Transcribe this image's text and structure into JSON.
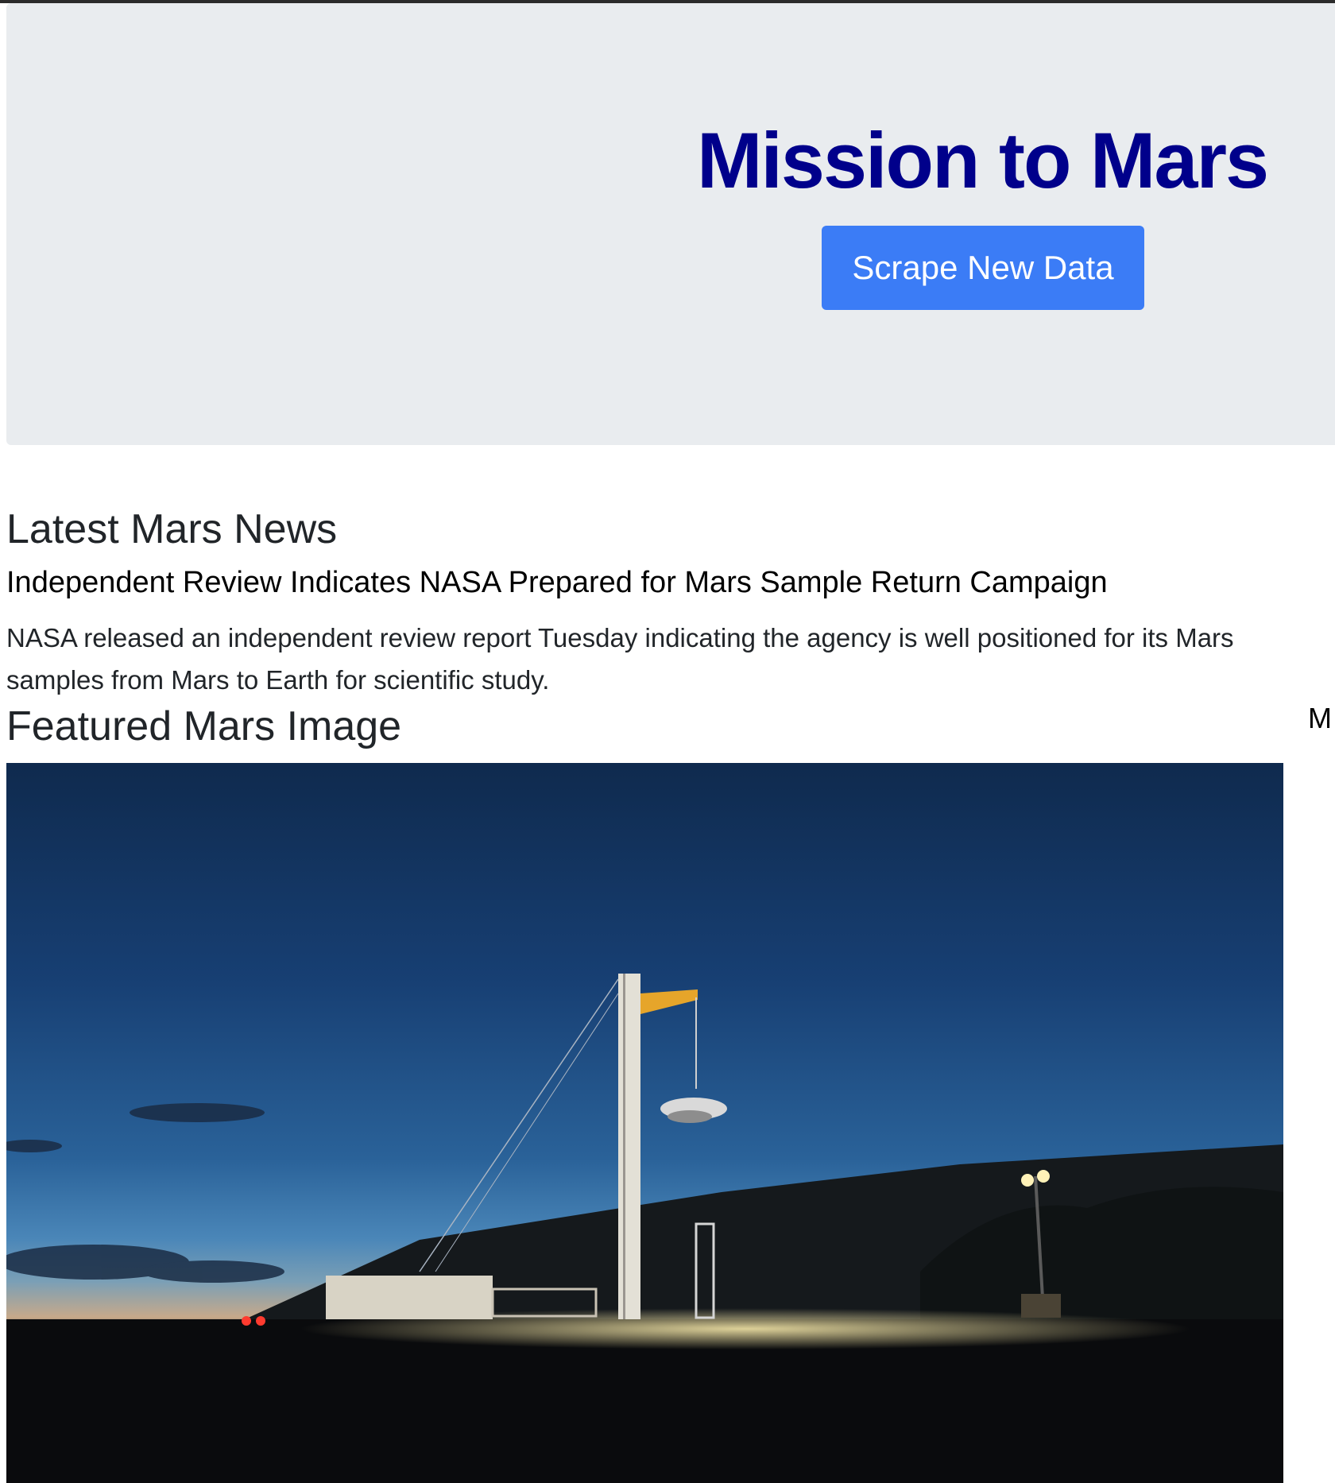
{
  "hero": {
    "title": "Mission to Mars",
    "button_label": "Scrape New Data"
  },
  "news": {
    "heading": "Latest Mars News",
    "title": "Independent Review Indicates NASA Prepared for Mars Sample Return Campaign",
    "paragraph_line1": "NASA released an independent review report Tuesday indicating the agency is well positioned for its Mars",
    "paragraph_line2": "samples from Mars to Earth for scientific study."
  },
  "featured": {
    "heading": "Featured Mars Image",
    "side_letter": "M"
  },
  "colors": {
    "title": "#00008b",
    "button": "#3b7cf6",
    "jumbotron": "#e9ecef"
  }
}
